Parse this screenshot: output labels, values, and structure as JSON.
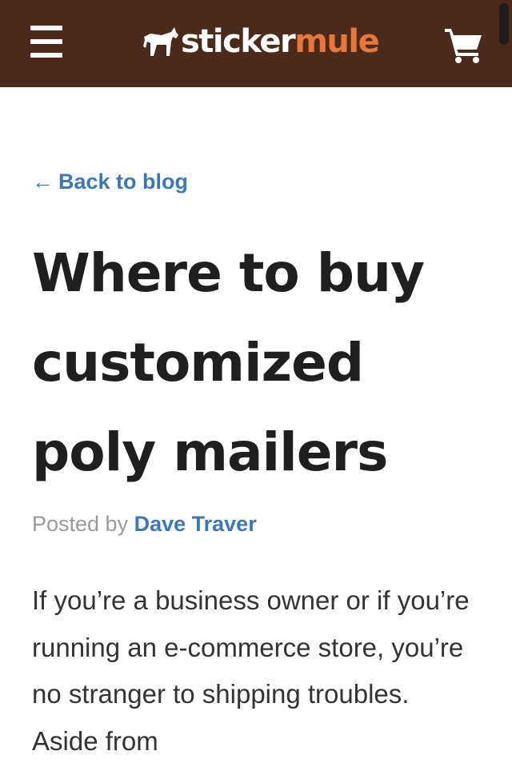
{
  "header": {
    "logo_word1": "sticker",
    "logo_word2": "mule",
    "colors": {
      "bar": "#4a2b1b",
      "logo_accent": "#e8773a",
      "link": "#3e78b4"
    },
    "menu_icon": "hamburger-icon",
    "cart_icon": "shopping-cart-icon"
  },
  "article": {
    "back_arrow": "←",
    "back_label": "Back to blog",
    "title": "Where to buy customized poly mailers",
    "byline_prefix": "Posted by",
    "author": "Dave Traver",
    "paragraph": "If you’re a business owner or if you’re running an e-commerce store, you’re no stranger to shipping troubles. Aside from"
  }
}
